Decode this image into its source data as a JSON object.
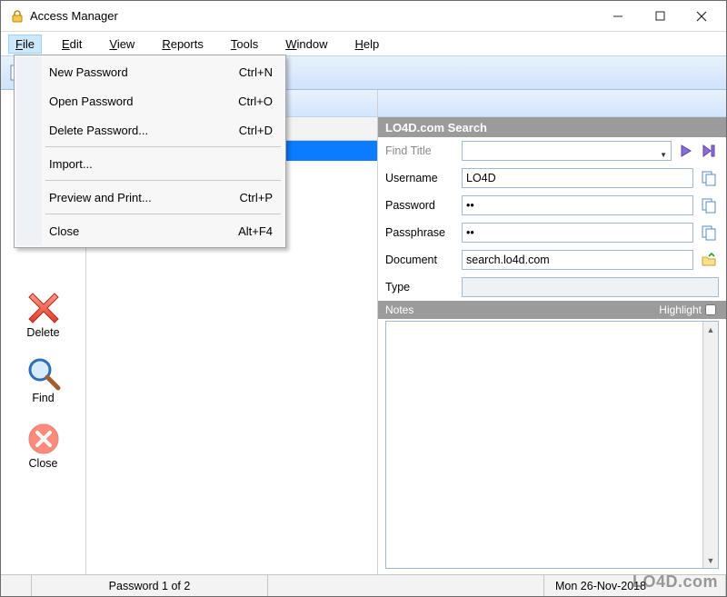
{
  "app": {
    "title": "Access Manager"
  },
  "menubar": {
    "items": [
      {
        "label": "File",
        "accel": "F"
      },
      {
        "label": "Edit",
        "accel": "E"
      },
      {
        "label": "View",
        "accel": "V"
      },
      {
        "label": "Reports",
        "accel": "R"
      },
      {
        "label": "Tools",
        "accel": "T"
      },
      {
        "label": "Window",
        "accel": "W"
      },
      {
        "label": "Help",
        "accel": "H"
      }
    ]
  },
  "file_menu": {
    "items": [
      {
        "label": "New Password",
        "accel": "N",
        "shortcut": "Ctrl+N"
      },
      {
        "label": "Open Password",
        "accel": "O",
        "shortcut": "Ctrl+O"
      },
      {
        "label": "Delete Password...",
        "accel": "D",
        "shortcut": "Ctrl+D"
      },
      "sep",
      {
        "label": "Import...",
        "accel": "I",
        "shortcut": ""
      },
      "sep",
      {
        "label": "Preview and Print...",
        "accel": "P",
        "shortcut": "Ctrl+P"
      },
      "sep",
      {
        "label": "Close",
        "accel": "C",
        "shortcut": "Alt+F4"
      }
    ]
  },
  "sidebar": {
    "delete_label": "Delete",
    "find_label": "Find",
    "close_label": "Close"
  },
  "panel": {
    "title": "LO4D.com Search",
    "find_title_label": "Find Title",
    "find_title_value": "",
    "username_label": "Username",
    "username_value": "LO4D",
    "password_label": "Password",
    "password_value": "••",
    "passphrase_label": "Passphrase",
    "passphrase_value": "••",
    "document_label": "Document",
    "document_value": "search.lo4d.com",
    "type_label": "Type",
    "type_value": "",
    "notes_label": "Notes",
    "highlight_label": "Highlight"
  },
  "status": {
    "count_text": "Password 1 of 2",
    "date_text": "Mon 26-Nov-2018"
  },
  "watermark": "LO4D.com"
}
